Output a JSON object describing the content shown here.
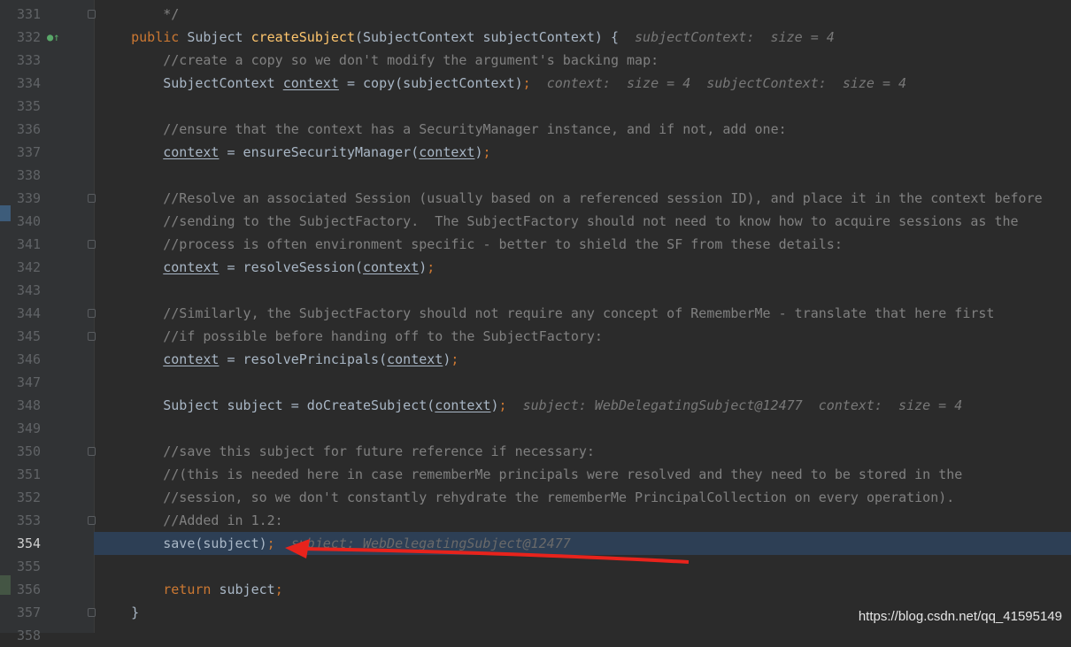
{
  "lines": [
    {
      "num": "331",
      "fold": true,
      "tokens": [
        {
          "t": "        */",
          "c": "cm"
        }
      ]
    },
    {
      "num": "332",
      "marker": "●↑",
      "tokens": [
        {
          "t": "    ",
          "c": "pl"
        },
        {
          "t": "public",
          "c": "kw"
        },
        {
          "t": " Subject ",
          "c": "pl"
        },
        {
          "t": "createSubject",
          "c": "fn"
        },
        {
          "t": "(SubjectContext subjectContext) {",
          "c": "pl"
        },
        {
          "t": "subjectContext:  size = 4",
          "c": "hint"
        }
      ]
    },
    {
      "num": "333",
      "tokens": [
        {
          "t": "        //create a copy so we don't modify the argument's backing map:",
          "c": "cm"
        }
      ]
    },
    {
      "num": "334",
      "tokens": [
        {
          "t": "        SubjectContext ",
          "c": "pl"
        },
        {
          "t": "context",
          "c": "pl ul"
        },
        {
          "t": " = copy(subjectContext)",
          "c": "pl"
        },
        {
          "t": ";",
          "c": "kw"
        },
        {
          "t": "context:  size = 4  subjectContext:  size = 4",
          "c": "hint"
        }
      ]
    },
    {
      "num": "335",
      "tokens": []
    },
    {
      "num": "336",
      "tokens": [
        {
          "t": "        //ensure that the context has a SecurityManager instance, and if not, add one:",
          "c": "cm"
        }
      ]
    },
    {
      "num": "337",
      "tokens": [
        {
          "t": "        ",
          "c": "pl"
        },
        {
          "t": "context",
          "c": "pl ul"
        },
        {
          "t": " = ensureSecurityManager(",
          "c": "pl"
        },
        {
          "t": "context",
          "c": "pl ul"
        },
        {
          "t": ")",
          "c": "pl"
        },
        {
          "t": ";",
          "c": "kw"
        }
      ]
    },
    {
      "num": "338",
      "tokens": []
    },
    {
      "num": "339",
      "fold": true,
      "tokens": [
        {
          "t": "        //Resolve an associated Session (usually based on a referenced session ID), and place it in the context before",
          "c": "cm"
        }
      ]
    },
    {
      "num": "340",
      "tokens": [
        {
          "t": "        //sending to the SubjectFactory.  The SubjectFactory should not need to know how to acquire sessions as the",
          "c": "cm"
        }
      ]
    },
    {
      "num": "341",
      "fold": true,
      "tokens": [
        {
          "t": "        //process is often environment specific - better to shield the SF from these details:",
          "c": "cm"
        }
      ]
    },
    {
      "num": "342",
      "tokens": [
        {
          "t": "        ",
          "c": "pl"
        },
        {
          "t": "context",
          "c": "pl ul"
        },
        {
          "t": " = resolveSession(",
          "c": "pl"
        },
        {
          "t": "context",
          "c": "pl ul"
        },
        {
          "t": ")",
          "c": "pl"
        },
        {
          "t": ";",
          "c": "kw"
        }
      ]
    },
    {
      "num": "343",
      "tokens": []
    },
    {
      "num": "344",
      "fold": true,
      "tokens": [
        {
          "t": "        //Similarly, the SubjectFactory should not require any concept of RememberMe - translate that here first",
          "c": "cm"
        }
      ]
    },
    {
      "num": "345",
      "fold": true,
      "tokens": [
        {
          "t": "        //if possible before handing off to the SubjectFactory:",
          "c": "cm"
        }
      ]
    },
    {
      "num": "346",
      "tokens": [
        {
          "t": "        ",
          "c": "pl"
        },
        {
          "t": "context",
          "c": "pl ul"
        },
        {
          "t": " = resolvePrincipals(",
          "c": "pl"
        },
        {
          "t": "context",
          "c": "pl ul"
        },
        {
          "t": ")",
          "c": "pl"
        },
        {
          "t": ";",
          "c": "kw"
        }
      ]
    },
    {
      "num": "347",
      "tokens": []
    },
    {
      "num": "348",
      "tokens": [
        {
          "t": "        Subject subject = doCreateSubject(",
          "c": "pl"
        },
        {
          "t": "context",
          "c": "pl ul"
        },
        {
          "t": ")",
          "c": "pl"
        },
        {
          "t": ";",
          "c": "kw"
        },
        {
          "t": "subject: WebDelegatingSubject@12477  context:  size = 4",
          "c": "hint"
        }
      ]
    },
    {
      "num": "349",
      "tokens": []
    },
    {
      "num": "350",
      "fold": true,
      "tokens": [
        {
          "t": "        //save this subject for future reference if necessary:",
          "c": "cm"
        }
      ]
    },
    {
      "num": "351",
      "tokens": [
        {
          "t": "        //(this is needed here in case rememberMe principals were resolved and they need to be stored in the",
          "c": "cm"
        }
      ]
    },
    {
      "num": "352",
      "tokens": [
        {
          "t": "        //session, so we don't constantly rehydrate the rememberMe PrincipalCollection on every operation).",
          "c": "cm"
        }
      ]
    },
    {
      "num": "353",
      "fold": true,
      "tokens": [
        {
          "t": "        //Added in 1.2:",
          "c": "cm"
        }
      ]
    },
    {
      "num": "354",
      "current": true,
      "tokens": [
        {
          "t": "        save(subject)",
          "c": "pl"
        },
        {
          "t": ";",
          "c": "kw"
        },
        {
          "t": "subject: WebDelegatingSubject@12477",
          "c": "hint dim"
        }
      ]
    },
    {
      "num": "355",
      "tokens": []
    },
    {
      "num": "356",
      "tokens": [
        {
          "t": "        ",
          "c": "pl"
        },
        {
          "t": "return",
          "c": "kw"
        },
        {
          "t": " subject",
          "c": "pl"
        },
        {
          "t": ";",
          "c": "kw"
        }
      ]
    },
    {
      "num": "357",
      "fold": true,
      "tokens": [
        {
          "t": "    }",
          "c": "pl"
        }
      ]
    },
    {
      "num": "358",
      "tokens": []
    }
  ],
  "colors": {
    "background": "#2b2b2b",
    "gutter": "#313335",
    "current_line": "#2d3f55",
    "arrow": "#e8231c"
  },
  "watermark": "https://blog.csdn.net/qq_41595149"
}
